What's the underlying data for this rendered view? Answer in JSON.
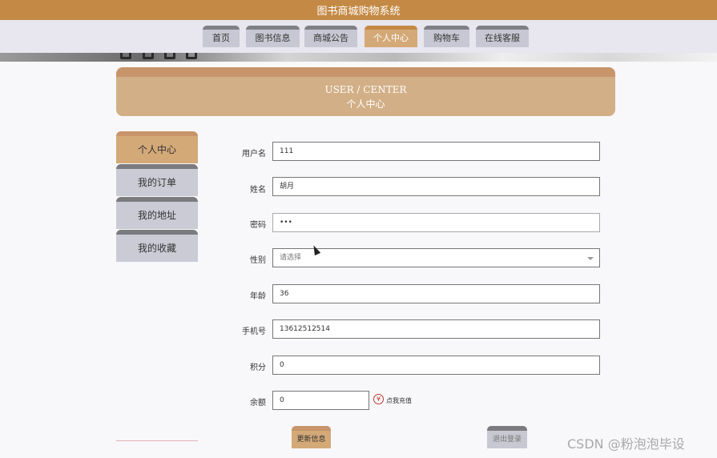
{
  "site": {
    "title": "图书商城购物系统"
  },
  "nav": {
    "items": [
      {
        "label": "首页"
      },
      {
        "label": "图书信息"
      },
      {
        "label": "商城公告"
      },
      {
        "label": "个人中心",
        "active": true
      },
      {
        "label": "购物车"
      },
      {
        "label": "在线客服"
      }
    ]
  },
  "header": {
    "title_en": "USER / CENTER",
    "title_cn": "个人中心"
  },
  "sidebar": {
    "items": [
      {
        "label": "个人中心",
        "active": true
      },
      {
        "label": "我的订单"
      },
      {
        "label": "我的地址"
      },
      {
        "label": "我的收藏"
      }
    ]
  },
  "form": {
    "username": {
      "label": "用户名",
      "value": "111"
    },
    "name": {
      "label": "姓名",
      "value": "胡月"
    },
    "password": {
      "label": "密码",
      "value": "•••"
    },
    "gender": {
      "label": "性别",
      "placeholder": "请选择"
    },
    "age": {
      "label": "年龄",
      "value": "36"
    },
    "phone": {
      "label": "手机号",
      "value": "13612512514"
    },
    "points": {
      "label": "积分",
      "value": "0"
    },
    "balance": {
      "label": "余额",
      "value": "0"
    },
    "recharge": {
      "icon": "yen-icon",
      "symbol": "¥",
      "label": "点我充值"
    },
    "update_label": "更新信息",
    "logout_label": "退出登录"
  },
  "watermark": "CSDN @粉泡泡毕设",
  "colors": {
    "brand": "#c48a45",
    "accent": "#d4a978",
    "inactive": "#c8c8d4"
  }
}
